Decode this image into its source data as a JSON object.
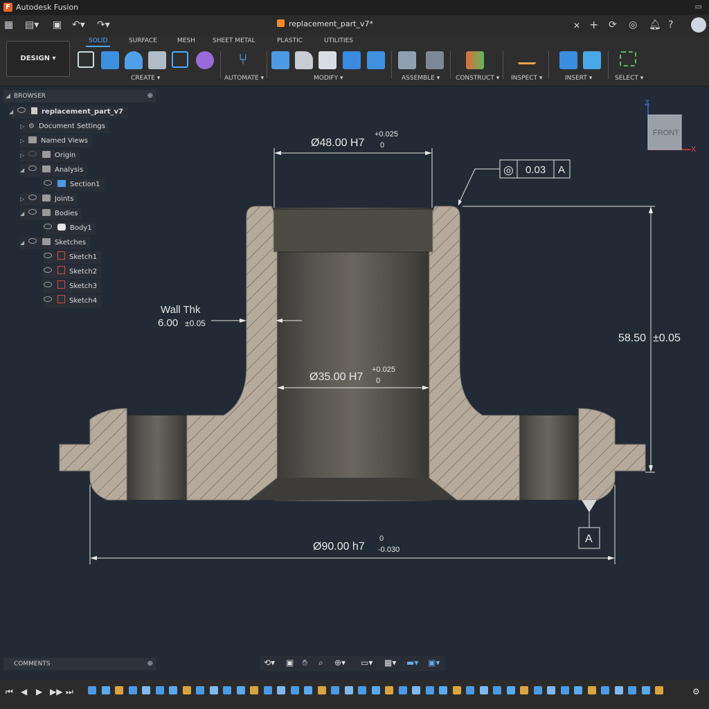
{
  "app": {
    "title": "Autodesk Fusion",
    "logo_letter": "F",
    "window_controls": "▭"
  },
  "document": {
    "name": "replacement_part_v7*"
  },
  "ribbon": {
    "mode": "DESIGN ▾",
    "tabs": [
      "SOLID",
      "SURFACE",
      "MESH",
      "SHEET METAL",
      "PLASTIC",
      "UTILITIES"
    ],
    "active_tab": "SOLID",
    "groups": [
      "CREATE ▾",
      "AUTOMATE ▾",
      "MODIFY ▾",
      "ASSEMBLE ▾",
      "CONSTRUCT ▾",
      "INSPECT ▾",
      "INSERT ▾",
      "SELECT ▾"
    ]
  },
  "browser": {
    "title": "BROWSER",
    "root": "replacement_part_v7",
    "items": [
      {
        "label": "Document Settings",
        "icon": "gear-icon"
      },
      {
        "label": "Named Views",
        "icon": "folder-icon"
      },
      {
        "label": "Origin",
        "icon": "folder-icon"
      },
      {
        "label": "Analysis",
        "icon": "folder-icon"
      },
      {
        "label": "Section1",
        "icon": "section-icon"
      },
      {
        "label": "Joints",
        "icon": "folder-icon"
      },
      {
        "label": "Bodies",
        "icon": "folder-icon"
      },
      {
        "label": "Body1",
        "icon": "body-icon"
      },
      {
        "label": "Sketches",
        "icon": "folder-icon"
      },
      {
        "label": "Sketch1",
        "icon": "sketch-icon"
      },
      {
        "label": "Sketch2",
        "icon": "sketch-icon"
      },
      {
        "label": "Sketch3",
        "icon": "sketch-icon"
      },
      {
        "label": "Sketch4",
        "icon": "sketch-icon"
      }
    ]
  },
  "comments": {
    "title": "COMMENTS"
  },
  "viewcube": {
    "face": "FRONT",
    "axis_z": "Z",
    "axis_x": "X"
  },
  "drawing": {
    "dim_top": {
      "text": "Ø48.00 H7",
      "upper": "+0.025",
      "lower": "0"
    },
    "fcf": {
      "symbol": "◎",
      "value": "0.03",
      "datum": "A"
    },
    "wall": {
      "label": "Wall Thk",
      "value": "6.00",
      "tol": "±0.05"
    },
    "dim_height": {
      "value": "58.50",
      "tol": "±0.05"
    },
    "dim_bore": {
      "text": "Ø35.00 H7",
      "upper": "+0.025",
      "lower": "0"
    },
    "dim_bottom": {
      "text": "Ø90.00 h7",
      "upper": "0",
      "lower": "-0.030"
    },
    "datum_label": "A"
  },
  "colors": {
    "canvas": "#222a35",
    "accent": "#4fa8ff",
    "section_fill": "#b5aa9c",
    "x_axis": "#e03a3a",
    "z_axis": "#3a6ae0"
  }
}
